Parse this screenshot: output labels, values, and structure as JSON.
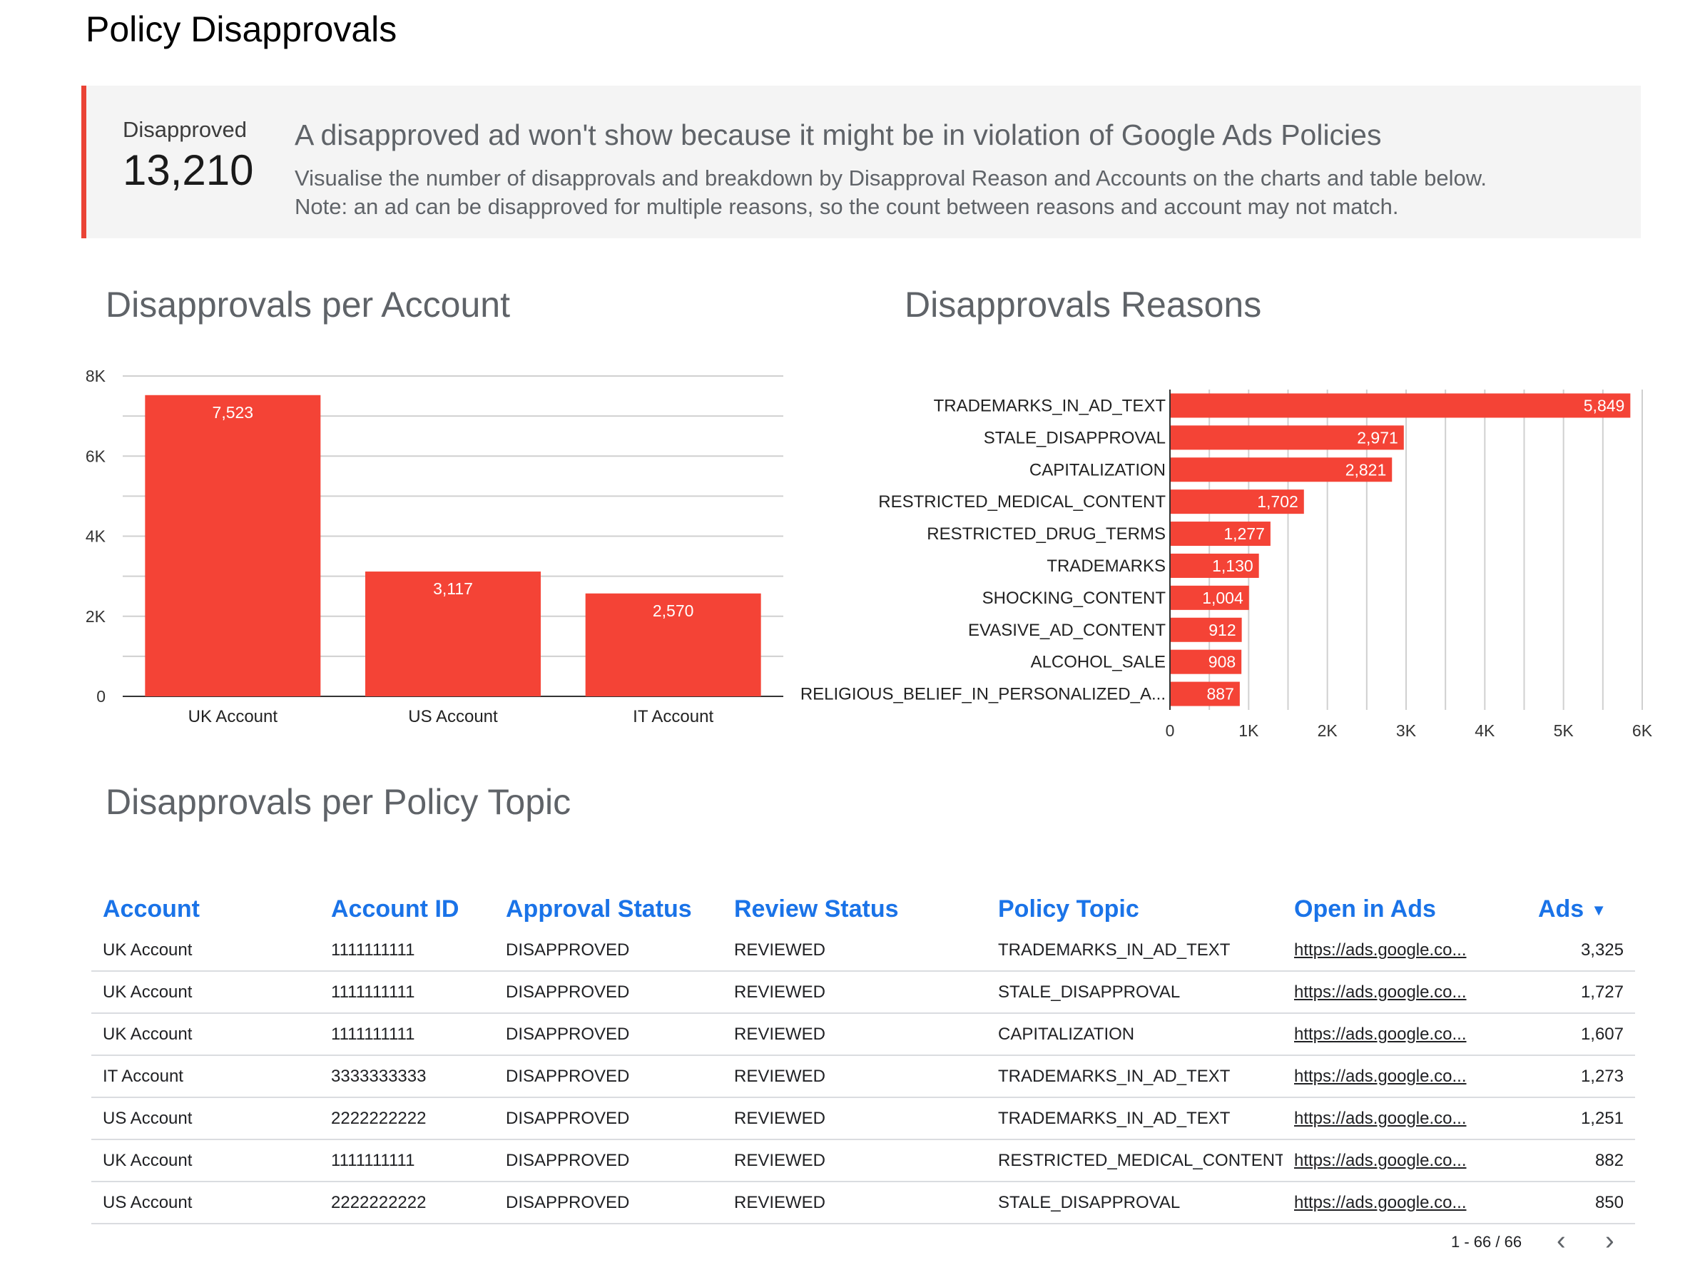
{
  "page_title": "Policy Disapprovals",
  "kpi": {
    "label": "Disapproved",
    "value": "13,210"
  },
  "banner": {
    "heading": "A disapproved ad won't show because it might be in violation of Google Ads Policies",
    "line1": "Visualise the number of disapprovals and breakdown by Disapproval Reason and Accounts on the charts and table below.",
    "line2": "Note: an ad can be disapproved for multiple reasons, so the count between reasons and account may not match."
  },
  "colors": {
    "bar": "#f44336",
    "accent_border": "#ea4335",
    "header_link": "#1a73e8"
  },
  "charts": {
    "per_account_title": "Disapprovals per Account",
    "reasons_title": "Disapprovals Reasons"
  },
  "chart_data": [
    {
      "type": "bar",
      "title": "Disapprovals per Account",
      "categories": [
        "UK Account",
        "US Account",
        "IT Account"
      ],
      "values": [
        7523,
        3117,
        2570
      ],
      "value_labels": [
        "7,523",
        "3,117",
        "2,570"
      ],
      "ylim": [
        0,
        8000
      ],
      "yticks": [
        0,
        2000,
        4000,
        6000,
        8000
      ],
      "ytick_labels": [
        "0",
        "2K",
        "4K",
        "6K",
        "8K"
      ],
      "grid": true
    },
    {
      "type": "bar",
      "orientation": "horizontal",
      "title": "Disapprovals Reasons",
      "categories": [
        "TRADEMARKS_IN_AD_TEXT",
        "STALE_DISAPPROVAL",
        "CAPITALIZATION",
        "RESTRICTED_MEDICAL_CONTENT",
        "RESTRICTED_DRUG_TERMS",
        "TRADEMARKS",
        "SHOCKING_CONTENT",
        "EVASIVE_AD_CONTENT",
        "ALCOHOL_SALE",
        "RELIGIOUS_BELIEF_IN_PERSONALIZED_A..."
      ],
      "values": [
        5849,
        2971,
        2821,
        1702,
        1277,
        1130,
        1004,
        912,
        908,
        887
      ],
      "value_labels": [
        "5,849",
        "2,971",
        "2,821",
        "1,702",
        "1,277",
        "1,130",
        "1,004",
        "912",
        "908",
        "887"
      ],
      "xlim": [
        0,
        6000
      ],
      "xticks": [
        0,
        1000,
        2000,
        3000,
        4000,
        5000,
        6000
      ],
      "xtick_labels": [
        "0",
        "1K",
        "2K",
        "3K",
        "4K",
        "5K",
        "6K"
      ],
      "grid": true
    }
  ],
  "table": {
    "title": "Disapprovals per Policy Topic",
    "columns": [
      "Account",
      "Account ID",
      "Approval Status",
      "Review Status",
      "Policy Topic",
      "Open in Ads",
      "Ads"
    ],
    "rows": [
      [
        "UK Account",
        "1111111111",
        "DISAPPROVED",
        "REVIEWED",
        "TRADEMARKS_IN_AD_TEXT",
        "https://ads.google.co...",
        "3,325"
      ],
      [
        "UK Account",
        "1111111111",
        "DISAPPROVED",
        "REVIEWED",
        "STALE_DISAPPROVAL",
        "https://ads.google.co...",
        "1,727"
      ],
      [
        "UK Account",
        "1111111111",
        "DISAPPROVED",
        "REVIEWED",
        "CAPITALIZATION",
        "https://ads.google.co...",
        "1,607"
      ],
      [
        "IT Account",
        "3333333333",
        "DISAPPROVED",
        "REVIEWED",
        "TRADEMARKS_IN_AD_TEXT",
        "https://ads.google.co...",
        "1,273"
      ],
      [
        "US Account",
        "2222222222",
        "DISAPPROVED",
        "REVIEWED",
        "TRADEMARKS_IN_AD_TEXT",
        "https://ads.google.co...",
        "1,251"
      ],
      [
        "UK Account",
        "1111111111",
        "DISAPPROVED",
        "REVIEWED",
        "RESTRICTED_MEDICAL_CONTENT",
        "https://ads.google.co...",
        "882"
      ],
      [
        "US Account",
        "2222222222",
        "DISAPPROVED",
        "REVIEWED",
        "STALE_DISAPPROVAL",
        "https://ads.google.co...",
        "850"
      ]
    ],
    "sort_icon": "triangle-down-icon",
    "pagination": "1 - 66 / 66",
    "prev_icon": "chevron-left-icon",
    "next_icon": "chevron-right-icon"
  }
}
